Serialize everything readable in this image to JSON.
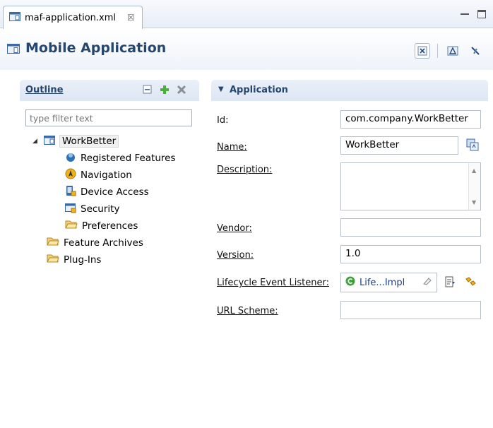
{
  "editor_tab": {
    "label": "maf-application.xml",
    "close_glyph": "☒"
  },
  "header": {
    "title": "Mobile Application"
  },
  "outline": {
    "title": "Outline",
    "filter_placeholder": "type filter text",
    "tree": [
      {
        "label": "WorkBetter",
        "icon": "app-icon",
        "level": 1,
        "expanded": true,
        "selected": true
      },
      {
        "label": "Registered Features",
        "icon": "features-icon",
        "level": 2
      },
      {
        "label": "Navigation",
        "icon": "navigation-icon",
        "level": 2
      },
      {
        "label": "Device Access",
        "icon": "device-access-icon",
        "level": 2
      },
      {
        "label": "Security",
        "icon": "security-icon",
        "level": 2
      },
      {
        "label": "Preferences",
        "icon": "folder-icon",
        "level": 2
      },
      {
        "label": "Feature Archives",
        "icon": "folder-icon",
        "level": 1
      },
      {
        "label": "Plug-Ins",
        "icon": "folder-icon",
        "level": 1
      }
    ]
  },
  "application": {
    "title": "Application",
    "id_label": "Id:",
    "id_value": "com.company.WorkBetter",
    "name_label": "Name:",
    "name_value": "WorkBetter",
    "description_label": "Description:",
    "description_value": "",
    "vendor_label": "Vendor:",
    "vendor_value": "",
    "version_label": "Version:",
    "version_value": "1.0",
    "lifecycle_label": "Lifecycle Event Listener:",
    "lifecycle_value": "Life...Impl",
    "url_scheme_label": "URL Scheme:",
    "url_scheme_value": ""
  },
  "colors": {
    "accent": "#26466d",
    "link": "#1a3e8a",
    "header_bg": "#eef3fa"
  }
}
